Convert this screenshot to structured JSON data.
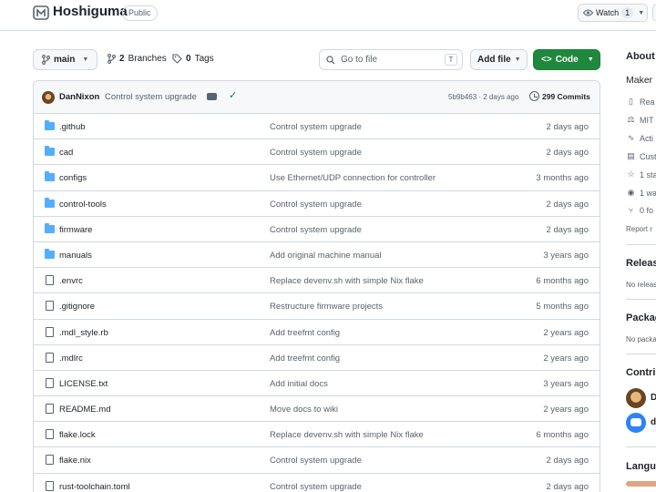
{
  "repo": {
    "name": "Hoshiguma",
    "visibility": "Public",
    "watch_label": "Watch",
    "watch_count": "1"
  },
  "toolbar": {
    "branch": "main",
    "branches_count": "2",
    "branches_label": "Branches",
    "tags_count": "0",
    "tags_label": "Tags",
    "search_placeholder": "Go to file",
    "search_shortcut": "T",
    "add_file_label": "Add file",
    "code_label": "Code"
  },
  "latest_commit": {
    "author": "DanNixon",
    "message": "Control system upgrade",
    "hash_and_time": "5b9b463 · 2 days ago",
    "commits_count": "299 Commits"
  },
  "files": [
    {
      "type": "dir",
      "name": ".github",
      "message": "Control system upgrade",
      "date": "2 days ago"
    },
    {
      "type": "dir",
      "name": "cad",
      "message": "Control system upgrade",
      "date": "2 days ago"
    },
    {
      "type": "dir",
      "name": "configs",
      "message": "Use Ethernet/UDP connection for controller",
      "date": "3 months ago"
    },
    {
      "type": "dir",
      "name": "control-tools",
      "message": "Control system upgrade",
      "date": "2 days ago"
    },
    {
      "type": "dir",
      "name": "firmware",
      "message": "Control system upgrade",
      "date": "2 days ago"
    },
    {
      "type": "dir",
      "name": "manuals",
      "message": "Add original machine manual",
      "date": "3 years ago"
    },
    {
      "type": "file",
      "name": ".envrc",
      "message": "Replace devenv.sh with simple Nix flake",
      "date": "6 months ago"
    },
    {
      "type": "file",
      "name": ".gitignore",
      "message": "Restructure firmware projects",
      "date": "5 months ago"
    },
    {
      "type": "file",
      "name": ".mdl_style.rb",
      "message": "Add treefmt config",
      "date": "2 years ago"
    },
    {
      "type": "file",
      "name": ".mdlrc",
      "message": "Add treefmt config",
      "date": "2 years ago"
    },
    {
      "type": "file",
      "name": "LICENSE.txt",
      "message": "Add initial docs",
      "date": "3 years ago"
    },
    {
      "type": "file",
      "name": "README.md",
      "message": "Move docs to wiki",
      "date": "2 years ago"
    },
    {
      "type": "file",
      "name": "flake.lock",
      "message": "Replace devenv.sh with simple Nix flake",
      "date": "6 months ago"
    },
    {
      "type": "file",
      "name": "flake.nix",
      "message": "Control system upgrade",
      "date": "2 days ago"
    },
    {
      "type": "file",
      "name": "rust-toolchain.toml",
      "message": "Control system upgrade",
      "date": "2 days ago"
    }
  ],
  "sidebar": {
    "about": "About",
    "description": "Maker",
    "links": [
      {
        "icon": "book-icon",
        "label": "Rea"
      },
      {
        "icon": "scale-icon",
        "label": "MIT"
      },
      {
        "icon": "activity-icon",
        "label": "Acti"
      },
      {
        "icon": "custom-icon",
        "label": "Cust"
      },
      {
        "icon": "star-icon",
        "label": "1 sta"
      },
      {
        "icon": "eye-icon",
        "label": "1 wa"
      },
      {
        "icon": "fork-icon",
        "label": "0 fo"
      }
    ],
    "report": "Report r",
    "releases_heading": "Releas",
    "releases_text": "No releas",
    "packages_heading": "Packag",
    "packages_text": "No packa",
    "contributors_heading": "Contri",
    "contributors": [
      {
        "initial": "D"
      },
      {
        "initial": "d"
      }
    ],
    "languages_heading": "Langua"
  }
}
